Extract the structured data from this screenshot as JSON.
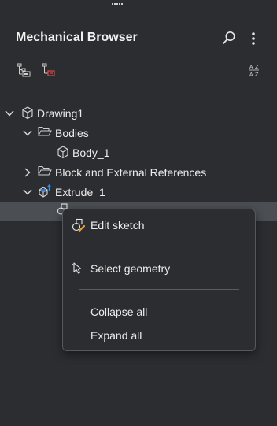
{
  "panel": {
    "title": "Mechanical Browser",
    "icons": {
      "search": "search-icon",
      "more": "more-vertical-icon",
      "tree_view": "tree-view-icon",
      "hierarchy": "hierarchy-icon",
      "sort": "sort-alpha-icon"
    }
  },
  "tree": [
    {
      "id": "drawing1",
      "label": "Drawing1",
      "expanded": true,
      "icon": "part-cube-icon"
    },
    {
      "id": "bodies",
      "label": "Bodies",
      "expanded": true,
      "icon": "folder-open-icon"
    },
    {
      "id": "body1",
      "label": "Body_1",
      "icon": "body-cube-icon"
    },
    {
      "id": "blockrefs",
      "label": "Block and External References",
      "expanded": false,
      "icon": "folder-open-icon"
    },
    {
      "id": "extrude1",
      "label": "Extrude_1",
      "expanded": true,
      "icon": "extrude-icon"
    },
    {
      "id": "sketch",
      "label": "",
      "selected": true,
      "icon": "sketch-icon"
    }
  ],
  "context_menu": {
    "items": [
      {
        "label": "Edit sketch",
        "icon": "edit-sketch-icon"
      },
      {
        "label": "Select geometry",
        "icon": "select-cursor-icon"
      },
      {
        "label": "Collapse all"
      },
      {
        "label": "Expand all"
      }
    ]
  },
  "colors": {
    "background": "#2b2d30",
    "selected_row": "#4b4e52",
    "accent_blue": "#3b8fe6",
    "accent_red": "#e04545",
    "accent_orange": "#f0a030"
  }
}
